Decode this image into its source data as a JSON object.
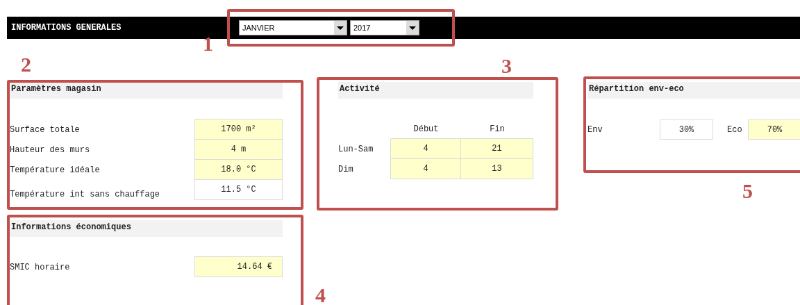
{
  "header": {
    "title": "INFORMATIONS GENERALES",
    "dropdowns": [
      {
        "value": "JANVIER"
      },
      {
        "value": "2017"
      }
    ]
  },
  "sections": [
    {
      "kind": "params",
      "title": "Paramètres magasin",
      "rows": [
        {
          "label": "Surface totale",
          "value": "1700 m²",
          "editable": true
        },
        {
          "label": "Hauteur des murs",
          "value": "4 m",
          "editable": true
        },
        {
          "label": "Température idéale",
          "value": "18.0 °C",
          "editable": true
        },
        {
          "label": "Température int sans chauffage",
          "value": "11.5 °C",
          "editable": false
        }
      ]
    },
    {
      "kind": "activity",
      "title": "Activité",
      "columns": [
        "Début",
        "Fin"
      ],
      "rows": [
        {
          "label": "Lun-Sam",
          "cells": [
            {
              "value": "4",
              "editable": true
            },
            {
              "value": "21",
              "editable": true
            }
          ]
        },
        {
          "label": "Dim",
          "cells": [
            {
              "value": "4",
              "editable": true
            },
            {
              "value": "13",
              "editable": true
            }
          ]
        }
      ]
    },
    {
      "kind": "split",
      "title": "Répartition env-eco",
      "items": [
        {
          "label": "Env",
          "value": "30%",
          "editable": false
        },
        {
          "label": "Eco",
          "value": "70%",
          "editable": true
        }
      ]
    },
    {
      "kind": "money",
      "title": "Informations économiques",
      "rows": [
        {
          "label": "SMIC horaire",
          "value": "14.64 €",
          "editable": true
        }
      ]
    }
  ],
  "annotations": [
    {
      "label": "1"
    },
    {
      "label": "2"
    },
    {
      "label": "3"
    },
    {
      "label": "4"
    },
    {
      "label": "5"
    }
  ]
}
